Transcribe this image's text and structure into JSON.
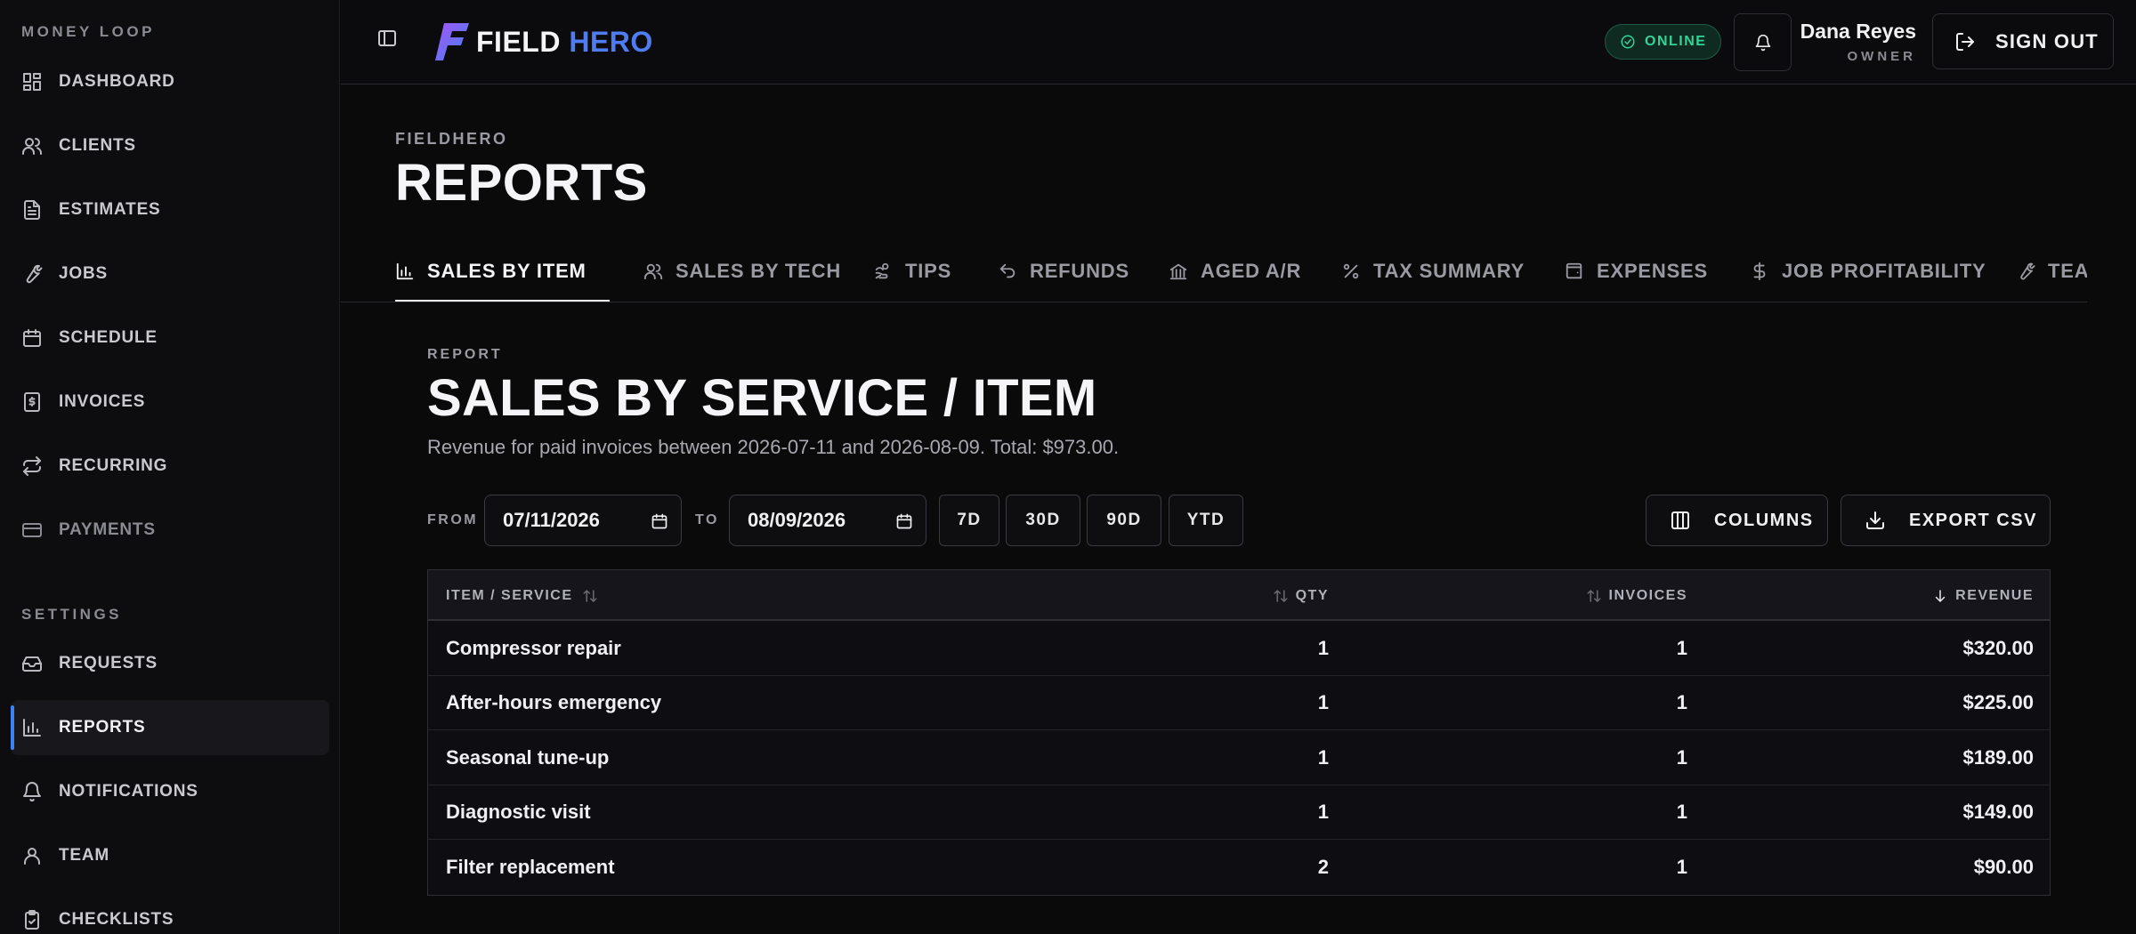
{
  "sidebar": {
    "section_main": "MONEY LOOP",
    "section_settings": "SETTINGS",
    "items": [
      {
        "label": "DASHBOARD",
        "icon": "dashboard-icon"
      },
      {
        "label": "CLIENTS",
        "icon": "users-icon"
      },
      {
        "label": "ESTIMATES",
        "icon": "file-icon"
      },
      {
        "label": "JOBS",
        "icon": "wrench-icon"
      },
      {
        "label": "SCHEDULE",
        "icon": "calendar-icon"
      },
      {
        "label": "INVOICES",
        "icon": "invoice-dollar-icon"
      },
      {
        "label": "RECURRING",
        "icon": "repeat-icon"
      },
      {
        "label": "PAYMENTS",
        "icon": "credit-card-icon"
      }
    ],
    "settings_items": [
      {
        "label": "REQUESTS",
        "icon": "inbox-icon"
      },
      {
        "label": "REPORTS",
        "icon": "bar-chart-icon",
        "active": true
      },
      {
        "label": "NOTIFICATIONS",
        "icon": "bell-icon"
      },
      {
        "label": "TEAM",
        "icon": "user-icon"
      },
      {
        "label": "CHECKLISTS",
        "icon": "clipboard-check-icon"
      }
    ]
  },
  "header": {
    "logo_word1": "FIELD",
    "logo_word2": "HERO",
    "status": "ONLINE",
    "user_name": "Dana Reyes",
    "user_role": "OWNER",
    "signout_label": "SIGN OUT"
  },
  "page": {
    "breadcrumb": "FIELDHERO",
    "title": "REPORTS"
  },
  "tabs": [
    {
      "label": "SALES BY ITEM",
      "icon": "bar-chart-icon",
      "active": true
    },
    {
      "label": "SALES BY TECH",
      "icon": "users-icon"
    },
    {
      "label": "TIPS",
      "icon": "hand-coins-icon"
    },
    {
      "label": "REFUNDS",
      "icon": "undo-icon"
    },
    {
      "label": "AGED A/R",
      "icon": "bank-icon"
    },
    {
      "label": "TAX SUMMARY",
      "icon": "percent-icon"
    },
    {
      "label": "EXPENSES",
      "icon": "wallet-icon"
    },
    {
      "label": "JOB PROFITABILITY",
      "icon": "dollar-icon"
    },
    {
      "label": "TEA",
      "icon": "wrench-icon"
    }
  ],
  "report": {
    "label": "REPORT",
    "title": "SALES BY SERVICE / ITEM",
    "description": "Revenue for paid invoices between 2026-07-11 and 2026-08-09. Total: $973.00.",
    "from_label": "FROM",
    "to_label": "TO",
    "from_value": "07/11/2026",
    "to_value": "08/09/2026",
    "presets": [
      "7D",
      "30D",
      "90D",
      "YTD"
    ],
    "columns_label": "COLUMNS",
    "export_label": "EXPORT CSV"
  },
  "table": {
    "headers": {
      "item": "ITEM / SERVICE",
      "qty": "QTY",
      "invoices": "INVOICES",
      "revenue": "REVENUE"
    },
    "rows": [
      {
        "item": "Compressor repair",
        "qty": "1",
        "invoices": "1",
        "revenue": "$320.00"
      },
      {
        "item": "After-hours emergency",
        "qty": "1",
        "invoices": "1",
        "revenue": "$225.00"
      },
      {
        "item": "Seasonal tune-up",
        "qty": "1",
        "invoices": "1",
        "revenue": "$189.00"
      },
      {
        "item": "Diagnostic visit",
        "qty": "1",
        "invoices": "1",
        "revenue": "$149.00"
      },
      {
        "item": "Filter replacement",
        "qty": "2",
        "invoices": "1",
        "revenue": "$90.00"
      }
    ]
  },
  "colors": {
    "accent": "#3b82f6",
    "online": "#34d399",
    "logo_blue": "#4f7cf0"
  }
}
